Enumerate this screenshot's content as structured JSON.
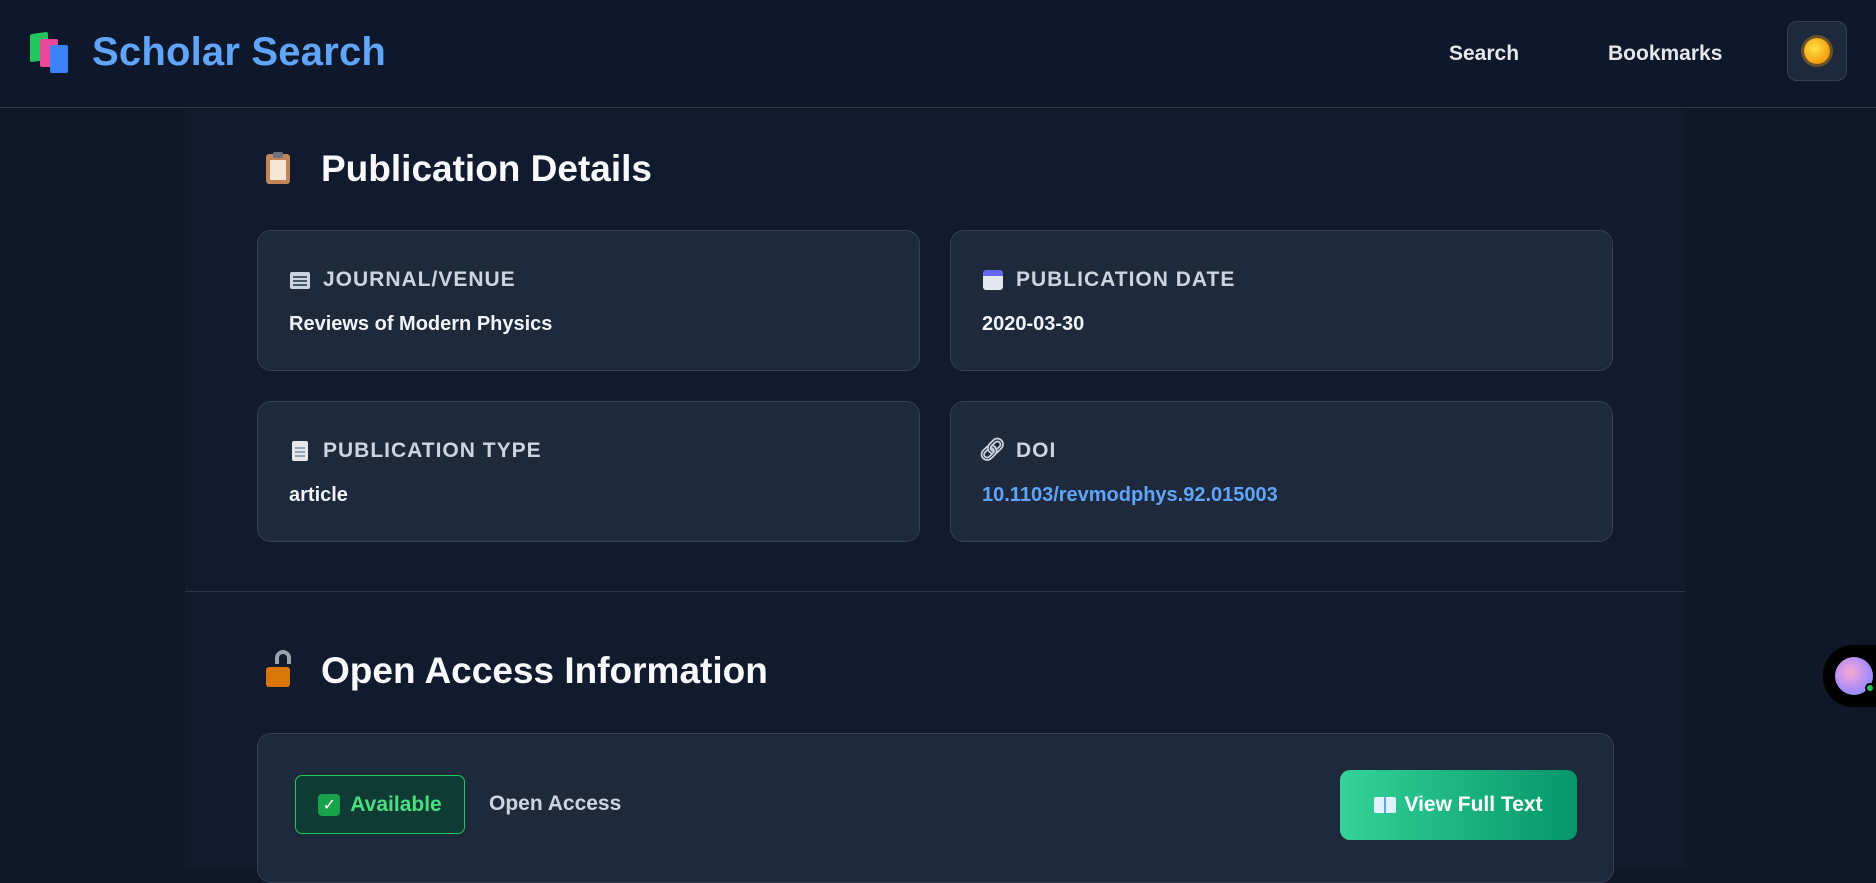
{
  "header": {
    "brand_title": "Scholar Search",
    "nav": {
      "search": "Search",
      "bookmarks": "Bookmarks"
    },
    "theme_icon": "sun-icon"
  },
  "publication": {
    "section_title": "Publication Details",
    "cards": [
      {
        "label": "JOURNAL/VENUE",
        "value": "Reviews of Modern Physics",
        "icon": "newspaper-icon"
      },
      {
        "label": "PUBLICATION DATE",
        "value": "2020-03-30",
        "icon": "calendar-icon"
      },
      {
        "label": "PUBLICATION TYPE",
        "value": "article",
        "icon": "document-icon"
      },
      {
        "label": "DOI",
        "value": "10.1103/revmodphys.92.015003",
        "icon": "link-icon"
      }
    ]
  },
  "open_access": {
    "section_title": "Open Access Information",
    "badge_label": "Available",
    "status_text": "Open Access",
    "view_button": "View Full Text"
  },
  "colors": {
    "brand": "#60a5fa",
    "accent_green": "#10b981",
    "background": "#0f1729",
    "card": "#1e293b"
  }
}
